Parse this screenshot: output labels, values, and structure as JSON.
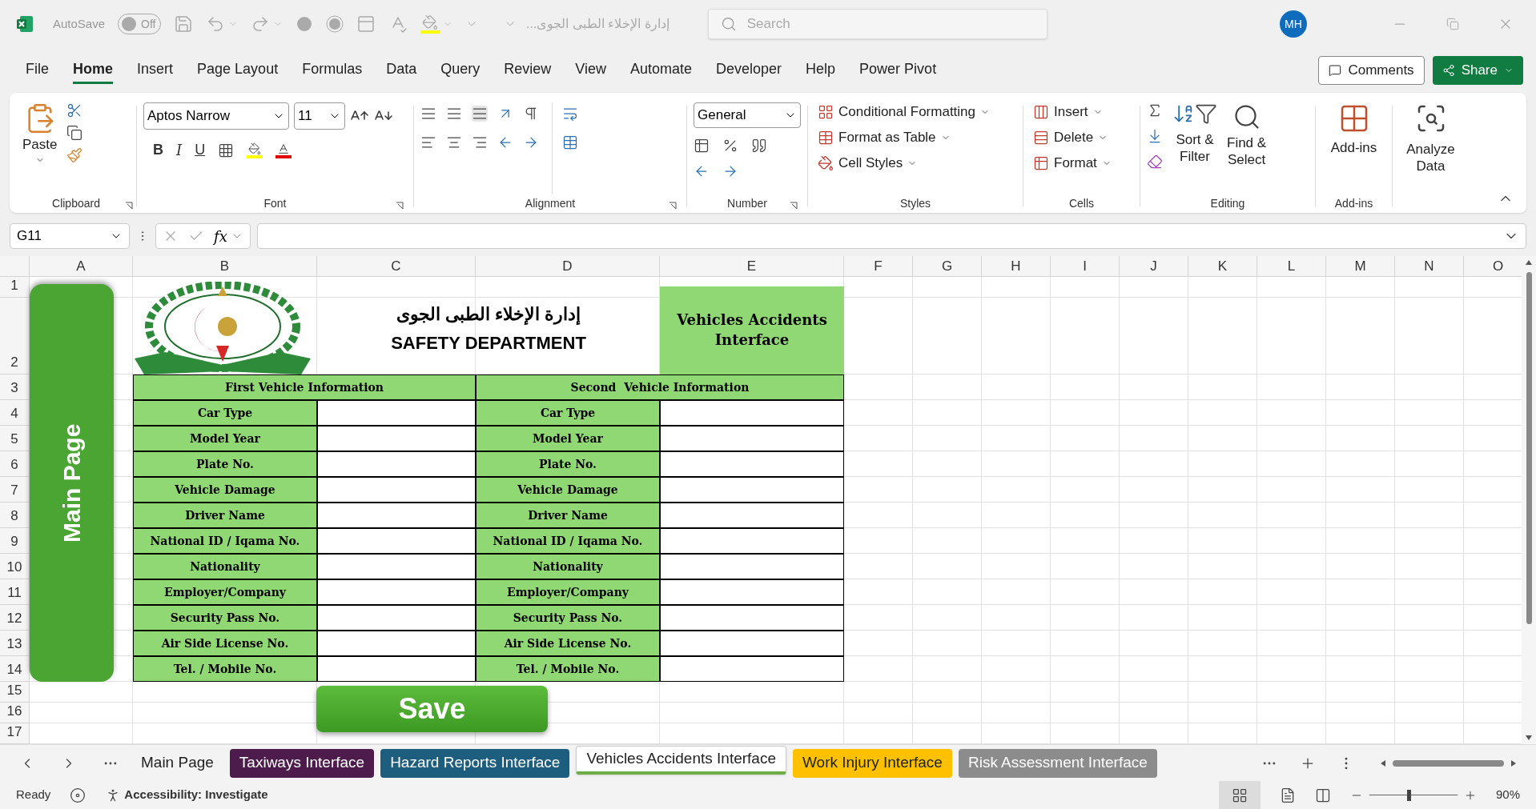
{
  "title_bar": {
    "autosave_label": "AutoSave",
    "autosave_state": "Off",
    "autosave_on": false,
    "document_title": "إدارة الإخلاء الطبى الجوى...",
    "search_placeholder": "Search",
    "user_initials": "MH"
  },
  "menu_tabs": [
    {
      "label": "File",
      "selected": false
    },
    {
      "label": "Home",
      "selected": true
    },
    {
      "label": "Insert",
      "selected": false
    },
    {
      "label": "Page Layout",
      "selected": false
    },
    {
      "label": "Formulas",
      "selected": false
    },
    {
      "label": "Data",
      "selected": false
    },
    {
      "label": "Query",
      "selected": false
    },
    {
      "label": "Review",
      "selected": false
    },
    {
      "label": "View",
      "selected": false
    },
    {
      "label": "Automate",
      "selected": false
    },
    {
      "label": "Developer",
      "selected": false
    },
    {
      "label": "Help",
      "selected": false
    },
    {
      "label": "Power Pivot",
      "selected": false
    }
  ],
  "actions": {
    "comments": "Comments",
    "share": "Share"
  },
  "ribbon": {
    "clipboard": {
      "paste": "Paste",
      "label": "Clipboard"
    },
    "font": {
      "font_name": "Aptos Narrow",
      "font_size": "11",
      "bold": "B",
      "italic": "I",
      "underline": "U",
      "label": "Font"
    },
    "alignment": {
      "label": "Alignment"
    },
    "number": {
      "format": "General",
      "label": "Number"
    },
    "styles": {
      "items": [
        "Conditional Formatting",
        "Format as Table",
        "Cell Styles"
      ],
      "label": "Styles"
    },
    "cells": {
      "items": [
        "Insert",
        "Delete",
        "Format"
      ],
      "label": "Cells"
    },
    "editing": {
      "sort": [
        "Sort &",
        "Filter"
      ],
      "find": [
        "Find &",
        "Select"
      ],
      "label": "Editing"
    },
    "addins": {
      "button": "Add-ins",
      "label": "Add-ins"
    },
    "analyze": {
      "button": [
        "Analyze",
        "Data"
      ]
    }
  },
  "formula_bar": {
    "name_box": "G11",
    "function_label": "fx"
  },
  "sheet": {
    "columns": [
      "A",
      "B",
      "C",
      "D",
      "E",
      "F",
      "G",
      "H",
      "I",
      "J",
      "K",
      "L",
      "M",
      "N",
      "O"
    ],
    "rows": [
      "1",
      "2",
      "3",
      "4",
      "5",
      "6",
      "7",
      "8",
      "9",
      "10",
      "11",
      "12",
      "13",
      "14",
      "15",
      "16",
      "17"
    ],
    "main_page_button": "Main Page",
    "save_button": "Save",
    "header": {
      "arabic": "إدارة الإخلاء الطبى الجوى",
      "english": "SAFETY DEPARTMENT",
      "interface_title": "Vehicles Accidents Interface"
    },
    "sections": [
      {
        "title": "First Vehicle Information",
        "fields": [
          "Car Type",
          "Model Year",
          "Plate No.",
          "Vehicle Damage",
          "Driver Name",
          "National ID / Iqama No.",
          "Nationality",
          "Employer/Company",
          "Security Pass No.",
          "Air Side License No.",
          "Tel. / Mobile No."
        ]
      },
      {
        "title": "Second  Vehicle Information",
        "fields": [
          "Car Type",
          "Model Year",
          "Plate No.",
          "Vehicle Damage",
          "Driver Name",
          "National ID / Iqama No.",
          "Nationality",
          "Employer/Company",
          "Security Pass No.",
          "Air Side License No.",
          "Tel. / Mobile No."
        ]
      }
    ]
  },
  "sheet_tabs": [
    {
      "label": "Main Page",
      "selected": false
    },
    {
      "label": "Taxiways Interface",
      "selected": false,
      "color": "#4e1b4d"
    },
    {
      "label": "Hazard Reports Interface",
      "selected": false,
      "color": "#1d5d7e"
    },
    {
      "label": "Vehicles Accidents Interface",
      "selected": true,
      "color": "#70ad47"
    },
    {
      "label": "Work Injury Interface",
      "selected": false,
      "color": "#ffc000"
    },
    {
      "label": "Risk Assessment Interface",
      "selected": false,
      "color": "#8c8c8c"
    }
  ],
  "status_bar": {
    "ready": "Ready",
    "accessibility": "Accessibility: Investigate",
    "zoom": "90%",
    "level": 0.45
  }
}
